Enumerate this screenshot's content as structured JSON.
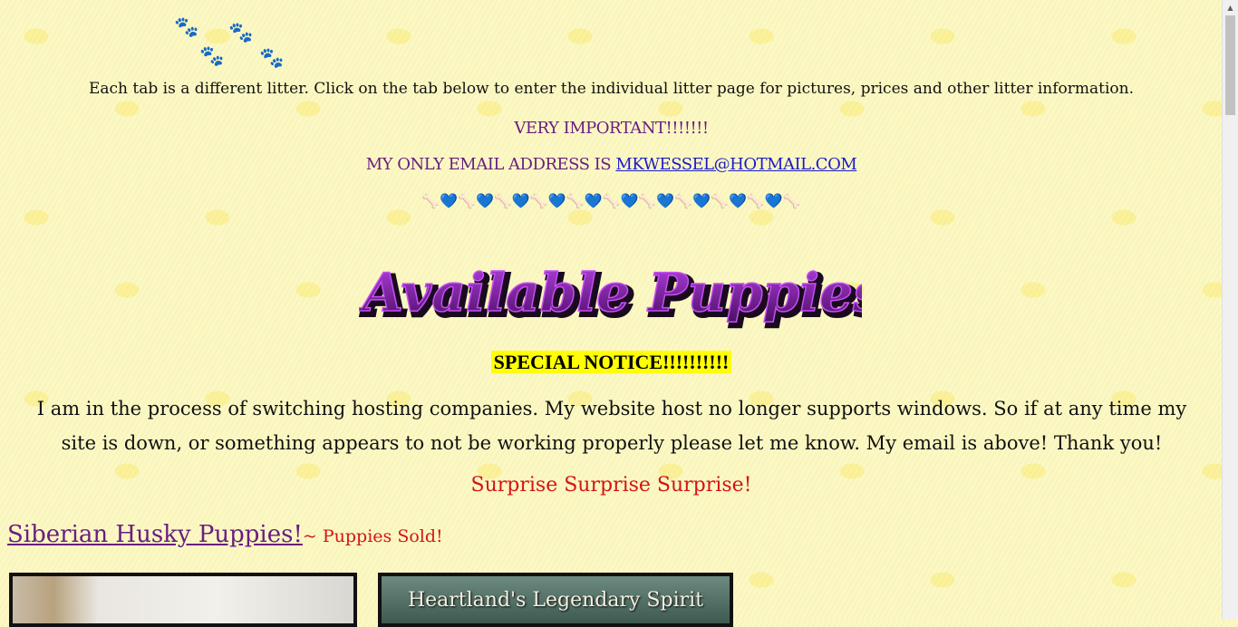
{
  "intro": "Each tab is a different litter.  Click on the tab below to enter the individual litter page for pictures, prices and other litter information.",
  "important": "VERY IMPORTANT!!!!!!!",
  "email_label": "MY ONLY EMAIL ADDRESS IS ",
  "email": "MKWESSEL@HOTMAIL.COM",
  "logo_text": "Available Puppies",
  "special_notice": "SPECIAL NOTICE!!!!!!!!!!",
  "paragraph": "I am in the process of switching hosting companies.  My website host no longer supports windows.  So if at any time my site is down, or something appears to not be working properly please let me know.  My email is above!  Thank you!",
  "surprise": "Surprise Surprise Surprise!",
  "husky_link": "Siberian Husky Puppies!",
  "husky_sold": "~ Puppies Sold!",
  "thumb2_title": "Heartland's Legendary Spirit",
  "colors": {
    "purple": "#6a1e80",
    "red": "#d41414",
    "link": "#1a1acc",
    "highlight": "#ffff00"
  }
}
